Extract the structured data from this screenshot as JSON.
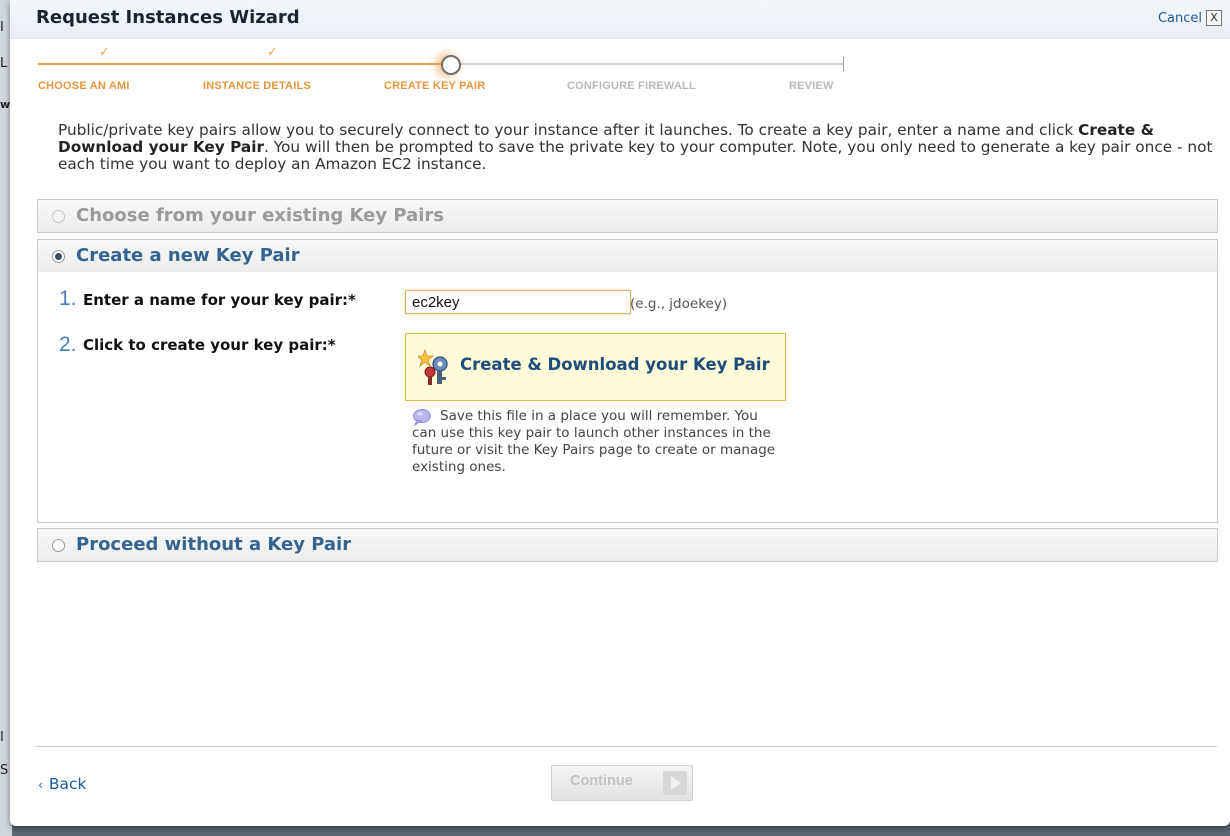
{
  "background_page": {
    "fragments": [
      "I",
      "L",
      "w",
      "I",
      "S"
    ]
  },
  "wizard": {
    "title": "Request Instances Wizard",
    "cancel_label": "Cancel",
    "close_glyph": "X"
  },
  "steps": [
    {
      "label": "CHOOSE AN AMI",
      "state": "done"
    },
    {
      "label": "INSTANCE DETAILS",
      "state": "done"
    },
    {
      "label": "CREATE KEY PAIR",
      "state": "current"
    },
    {
      "label": "CONFIGURE FIREWALL",
      "state": "future"
    },
    {
      "label": "REVIEW",
      "state": "future"
    }
  ],
  "check_glyph": "✓",
  "intro": {
    "part1": "Public/private key pairs allow you to securely connect to your instance after it launches. To create a key pair, enter a name and click ",
    "bold": "Create & Download your Key Pair",
    "part2": ". You will then be prompted to save the private key to your computer. Note, you only need to generate a key pair once - not each time you want to deploy an Amazon EC2 instance."
  },
  "options": {
    "existing": {
      "label": "Choose from your existing Key Pairs",
      "selected": false,
      "enabled": false
    },
    "create_new": {
      "label": "Create a new Key Pair",
      "selected": true,
      "enabled": true
    },
    "none": {
      "label": "Proceed without a Key Pair",
      "selected": false,
      "enabled": true
    }
  },
  "create_form": {
    "step1_number": "1.",
    "step1_label": "Enter a name for your key pair:*",
    "key_name_value": "ec2key",
    "key_name_hint": "(e.g., jdoekey)",
    "step2_number": "2.",
    "step2_label": "Click to create your key pair:*",
    "create_button_label": "Create & Download your Key Pair",
    "save_note": "Save this file in a place you will remember. You can use this key pair to launch other instances in the future or visit the Key Pairs page to create or manage existing ones."
  },
  "footer": {
    "back_chevron": "‹",
    "back_label": "Back",
    "continue_label": "Continue"
  },
  "colors": {
    "accent_orange": "#f0a050",
    "link_blue": "#1e5b96",
    "panel_title_blue": "#35638f",
    "step_number_blue": "#4a7bb7",
    "button_yellow": "#fdfbd8"
  },
  "icons": {
    "close": "close-icon",
    "check": "check-icon",
    "radio": "radio-icon",
    "keys": "keys-icon",
    "speech_bubble": "speech-bubble-icon",
    "arrow_right": "arrow-right-icon"
  }
}
